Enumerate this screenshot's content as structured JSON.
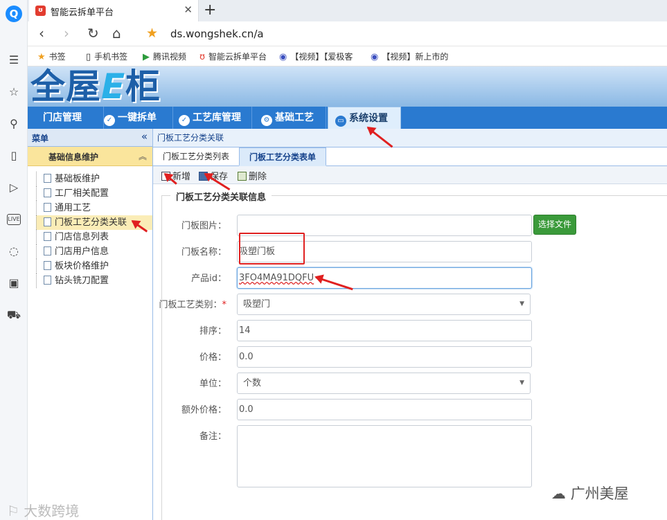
{
  "browser": {
    "tab_title": "智能云拆单平台",
    "tab_favicon": "yunchai-icon",
    "url": "ds.wongshek.cn/a",
    "bookmarks": [
      {
        "label": "书签",
        "icon": "star-icon"
      },
      {
        "label": "手机书签",
        "icon": "phone-icon"
      },
      {
        "label": "腾讯视频",
        "icon": "tencent-video-icon"
      },
      {
        "label": "智能云拆单平台",
        "icon": "yunchai-icon"
      },
      {
        "label": "【视频】【爱极客",
        "icon": "video-icon"
      },
      {
        "label": "【视频】新上市的",
        "icon": "video-icon"
      }
    ]
  },
  "app": {
    "brand": "全屋E柜",
    "brand_pre": "全屋",
    "brand_e": "E",
    "brand_post": "柜",
    "main_nav": [
      {
        "label": "门店管理",
        "icon": ""
      },
      {
        "label": "一键拆单",
        "icon": "check-icon"
      },
      {
        "label": "工艺库管理",
        "icon": "check-icon"
      },
      {
        "label": "基础工艺",
        "icon": "gear-icon"
      },
      {
        "label": "系统设置",
        "icon": "monitor-icon",
        "active": true
      }
    ]
  },
  "sidebar": {
    "title": "菜单",
    "collapse_glyph": "«",
    "section": "基础信息维护",
    "section_glyph": "︽",
    "items": [
      {
        "label": "基础板维护"
      },
      {
        "label": "工厂相关配置"
      },
      {
        "label": "通用工艺"
      },
      {
        "label": "门板工艺分类关联",
        "selected": true
      },
      {
        "label": "门店信息列表"
      },
      {
        "label": "门店用户信息"
      },
      {
        "label": "板块价格维护"
      },
      {
        "label": "钻头铣刀配置"
      }
    ]
  },
  "content": {
    "breadcrumb": "门板工艺分类关联",
    "tabs": [
      {
        "label": "门板工艺分类列表"
      },
      {
        "label": "门板工艺分类表单",
        "active": true
      }
    ],
    "toolbar": {
      "new_label": "新增",
      "save_label": "保存",
      "delete_label": "删除"
    },
    "form": {
      "legend": "门板工艺分类关联信息",
      "image_label": "门板图片：",
      "image_value": "",
      "choose_file_label": "选择文件",
      "name_label": "门板名称：",
      "name_value": "吸塑门板",
      "product_id_label": "产品id：",
      "product_id_value": "3FO4MA91DQFU",
      "category_label": "门板工艺类别：",
      "category_required": "*",
      "category_value": "吸塑门",
      "sort_label": "排序：",
      "sort_value": "14",
      "price_label": "价格：",
      "price_value": "0.0",
      "unit_label": "单位：",
      "unit_value": "个数",
      "extra_price_label": "额外价格：",
      "extra_price_value": "0.0",
      "remark_label": "备注：",
      "remark_value": ""
    }
  },
  "watermarks": {
    "left": "大数跨境",
    "right": "广州美屋"
  },
  "colors": {
    "nav_blue": "#2a7ad0",
    "annotation_red": "#e02020",
    "file_button_green": "#3a9a3a",
    "selected_yellow": "#fbedb7"
  }
}
